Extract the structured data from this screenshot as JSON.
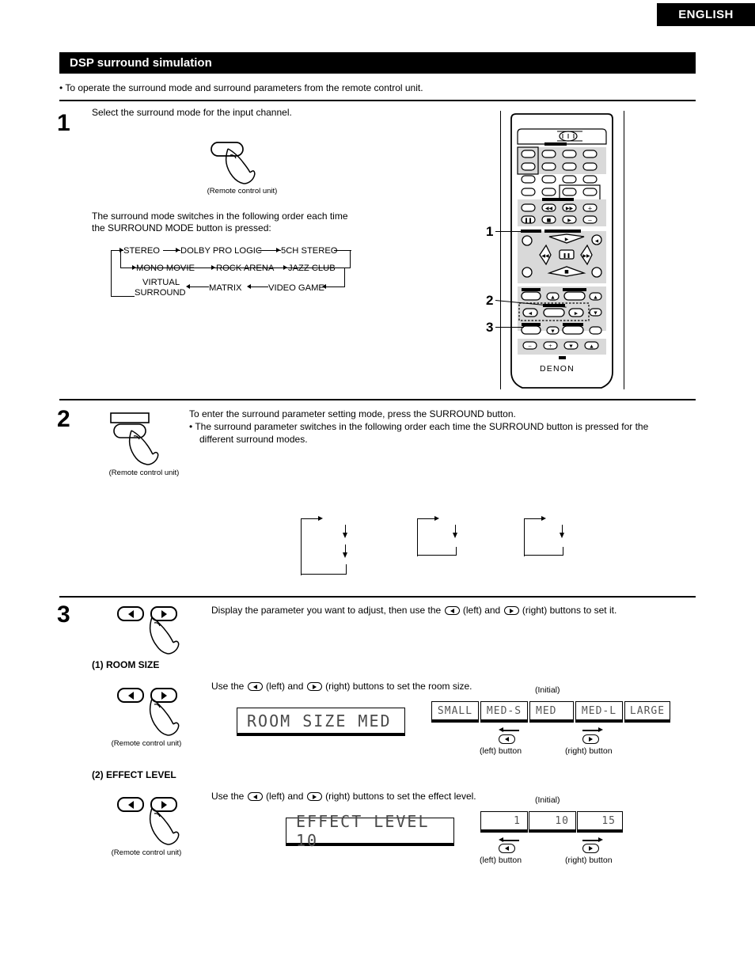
{
  "header": {
    "language_tab": "ENGLISH",
    "section_title": "DSP surround simulation",
    "intro_bullet": "• To operate the surround mode and surround parameters from the remote control unit."
  },
  "steps": {
    "step1": {
      "number": "1",
      "instruction": "Select the surround mode for the input channel.",
      "remote_caption": "(Remote control unit)",
      "description_line1": "The surround mode switches in the following order each time",
      "description_line2": "the SURROUND MODE button is pressed:",
      "mode_sequence": [
        "STEREO",
        "DOLBY PRO LOGIC",
        "5CH STEREO",
        "MONO MOVIE",
        "ROCK ARENA",
        "JAZZ CLUB",
        "VIDEO GAME",
        "MATRIX",
        "VIRTUAL SURROUND"
      ],
      "mode_row3_labels": {
        "virtual_line1": "VIRTUAL",
        "virtual_line2": "SURROUND",
        "matrix": "MATRIX",
        "video_game": "VIDEO GAME"
      }
    },
    "step2": {
      "number": "2",
      "remote_caption": "(Remote control unit)",
      "line1": "To enter the surround parameter setting mode, press the SURROUND button.",
      "line2": "• The surround parameter switches in the following order each time the SURROUND button is pressed for the",
      "line3": "different surround modes."
    },
    "step3": {
      "number": "3",
      "instruction_pre": "Display the parameter you want to adjust, then use the",
      "instruction_mid": "(left) and",
      "instruction_post": "(right) buttons to set it.",
      "params": [
        {
          "label": "(1)  ROOM SIZE",
          "remote_caption": "(Remote control unit)",
          "use_text_pre": "Use the",
          "use_text_mid": "(left) and",
          "use_text_post": "(right) buttons to set the room size.",
          "display_value": "ROOM SIZE MED",
          "initial_label": "(Initial)",
          "options": [
            "SMALL",
            "MED-S",
            "MED",
            "MED-L",
            "LARGE"
          ],
          "initial_index": 2,
          "left_button_label": "(left) button",
          "right_button_label": "(right) button"
        },
        {
          "label": "(2)  EFFECT LEVEL",
          "remote_caption": "(Remote control unit)",
          "use_text_pre": "Use the",
          "use_text_mid": "(left) and",
          "use_text_post": "(right) buttons to set the effect level.",
          "display_value": "EFFECT LEVEL 10",
          "initial_label": "(Initial)",
          "options": [
            "1",
            "10",
            "15"
          ],
          "initial_index": 1,
          "left_button_label": "(left) button",
          "right_button_label": "(right) button"
        }
      ]
    }
  },
  "remote": {
    "brand": "DENON",
    "callouts": [
      "1",
      "2",
      "3"
    ]
  },
  "colors": {
    "ink": "#000000",
    "panel_gray": "#d9d9d9",
    "lcd_text": "#4a4a4a"
  }
}
